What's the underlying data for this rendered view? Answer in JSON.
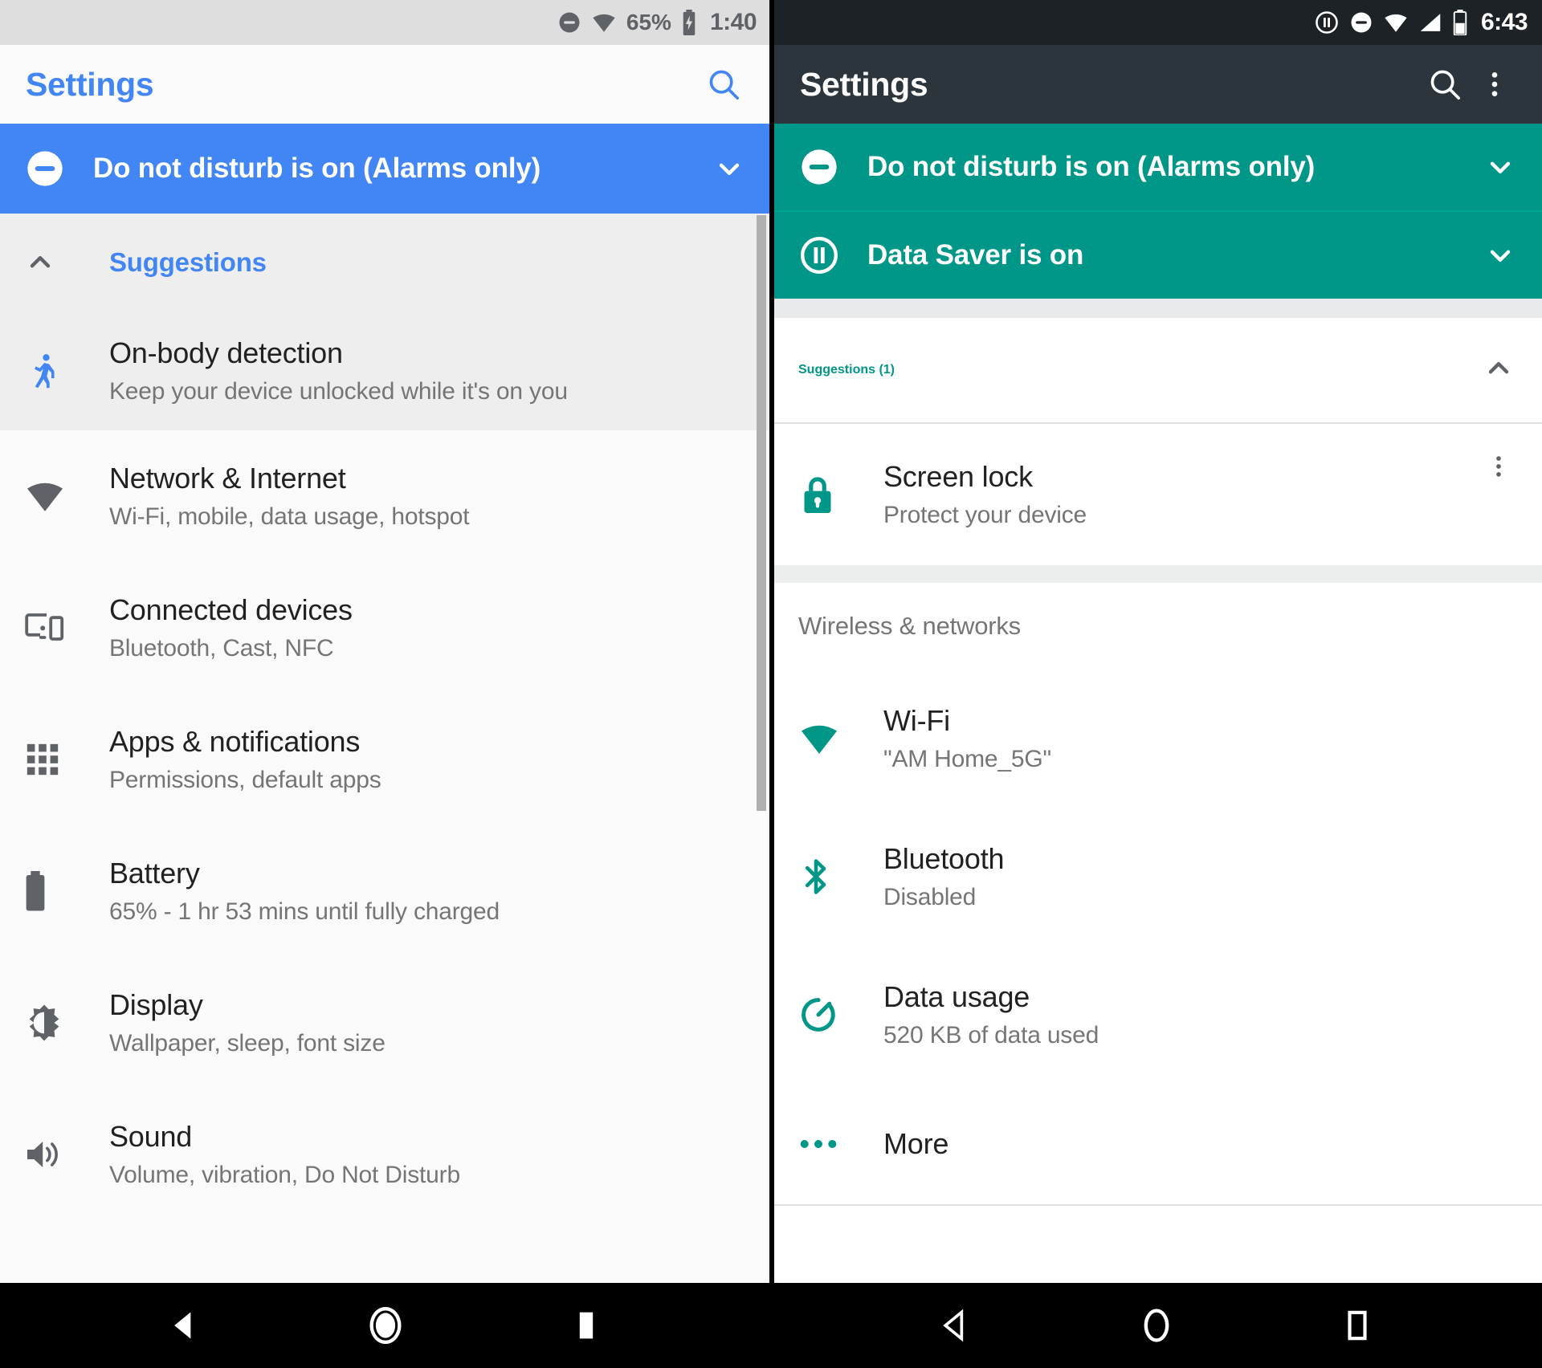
{
  "left_phone": {
    "statusbar": {
      "icons": [
        "do-not-disturb-icon",
        "wifi-icon"
      ],
      "battery_percent": "65%",
      "battery_icon": "battery-charging-icon",
      "clock": "1:40"
    },
    "toolbar": {
      "title": "Settings",
      "search_icon": "search-icon"
    },
    "banner": {
      "icon": "do-not-disturb-icon",
      "text": "Do not disturb is on (Alarms only)",
      "chevron": "chevron-down-icon",
      "color": "#4285f4"
    },
    "suggestions": {
      "header_label": "Suggestions",
      "header_arrow": "chevron-up-icon",
      "items": [
        {
          "icon": "walking-person-icon",
          "title": "On-body detection",
          "subtitle": "Keep your device unlocked while it's on you"
        }
      ]
    },
    "list": [
      {
        "icon": "wifi-icon",
        "title": "Network & Internet",
        "subtitle": "Wi-Fi, mobile, data usage, hotspot"
      },
      {
        "icon": "connected-devices-icon",
        "title": "Connected devices",
        "subtitle": "Bluetooth, Cast, NFC"
      },
      {
        "icon": "apps-grid-icon",
        "title": "Apps & notifications",
        "subtitle": "Permissions, default apps"
      },
      {
        "icon": "battery-icon",
        "title": "Battery",
        "subtitle": "65% - 1 hr 53 mins until fully charged"
      },
      {
        "icon": "brightness-icon",
        "title": "Display",
        "subtitle": "Wallpaper, sleep, font size"
      },
      {
        "icon": "volume-icon",
        "title": "Sound",
        "subtitle": "Volume, vibration, Do Not Disturb"
      }
    ],
    "navbar": {
      "back": "back-triangle-icon",
      "home": "home-circle-icon",
      "recents": "recents-square-icon"
    }
  },
  "right_phone": {
    "statusbar": {
      "icons": [
        "data-saver-pause-icon",
        "do-not-disturb-icon",
        "wifi-icon",
        "signal-icon"
      ],
      "battery_icon": "battery-icon",
      "clock": "6:43"
    },
    "toolbar": {
      "title": "Settings",
      "search_icon": "search-icon",
      "overflow_icon": "overflow-menu-icon"
    },
    "banners": [
      {
        "icon": "do-not-disturb-icon",
        "text": "Do not disturb is on (Alarms only)",
        "chevron": "chevron-down-icon"
      },
      {
        "icon": "data-saver-pause-icon",
        "text": "Data Saver is on",
        "chevron": "chevron-down-icon"
      }
    ],
    "banner_color": "#009688",
    "suggestions": {
      "header_label": "Suggestions (1)",
      "header_arrow": "chevron-up-icon",
      "items": [
        {
          "icon": "lock-icon",
          "title": "Screen lock",
          "subtitle": "Protect your device",
          "overflow_icon": "overflow-menu-icon"
        }
      ]
    },
    "section": {
      "label": "Wireless & networks",
      "items": [
        {
          "icon": "wifi-icon",
          "title": "Wi-Fi",
          "subtitle": "\"AM Home_5G\""
        },
        {
          "icon": "bluetooth-icon",
          "title": "Bluetooth",
          "subtitle": "Disabled"
        },
        {
          "icon": "data-usage-icon",
          "title": "Data usage",
          "subtitle": "520 KB of data used"
        },
        {
          "icon": "more-dots-icon",
          "title": "More",
          "subtitle": ""
        }
      ]
    },
    "navbar": {
      "back": "back-triangle-outline-icon",
      "home": "home-circle-outline-icon",
      "recents": "recents-square-outline-icon"
    }
  }
}
